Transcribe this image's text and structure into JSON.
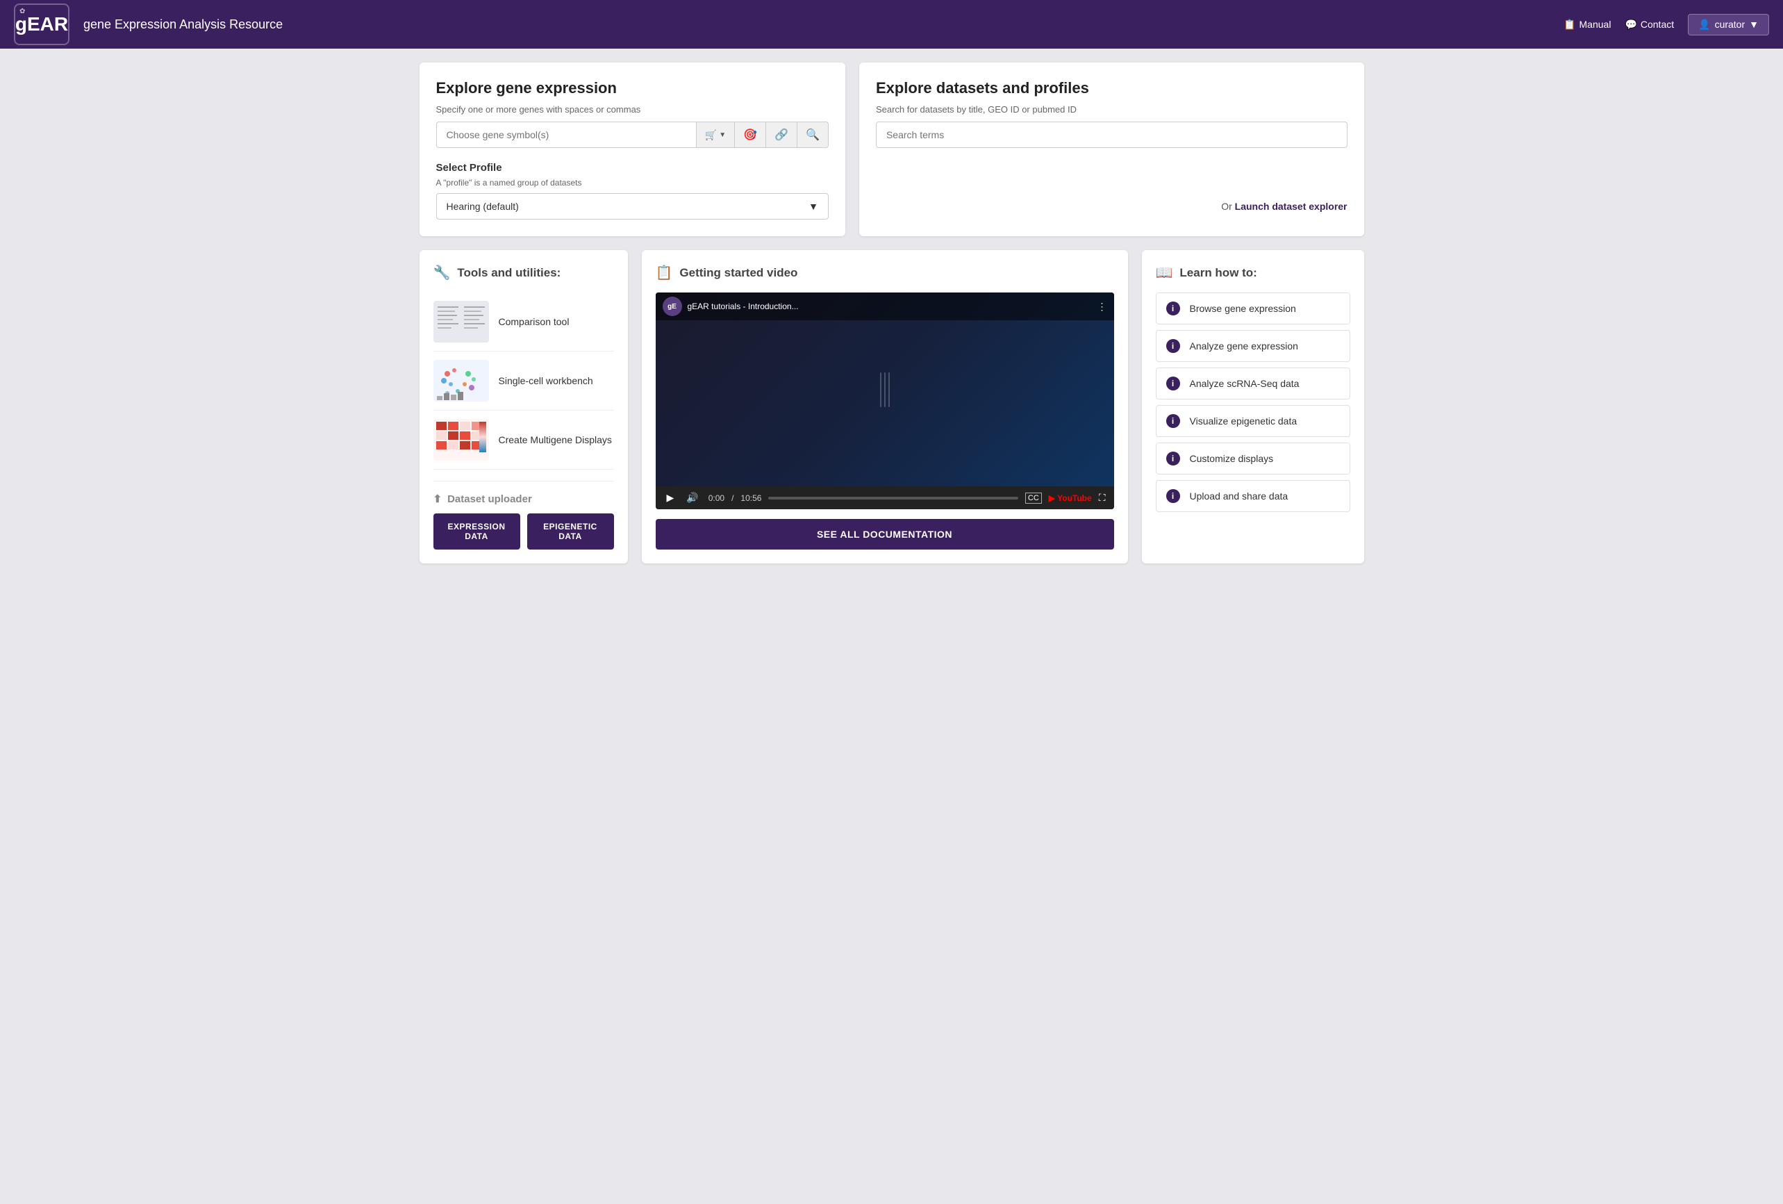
{
  "header": {
    "logo_text": "gEAR",
    "title": "gene Expression Analysis Resource",
    "manual_label": "Manual",
    "contact_label": "Contact",
    "curator_label": "curator"
  },
  "explore_gene": {
    "title": "Explore gene expression",
    "subtitle": "Specify one or more genes with spaces or commas",
    "input_placeholder": "Choose gene symbol(s)",
    "cart_label": "🛒",
    "profile_section_label": "Select Profile",
    "profile_desc": "A \"profile\" is a named group of datasets",
    "profile_value": "Hearing (default)"
  },
  "explore_datasets": {
    "title": "Explore datasets and profiles",
    "subtitle": "Search for datasets by title, GEO ID or pubmed ID",
    "search_placeholder": "Search terms",
    "launch_prefix": "Or ",
    "launch_label": "Launch dataset explorer"
  },
  "tools": {
    "section_label": "Tools and utilities:",
    "items": [
      {
        "label": "Comparison tool"
      },
      {
        "label": "Single-cell workbench"
      },
      {
        "label": "Create Multigene Displays"
      }
    ]
  },
  "dataset_uploader": {
    "label": "Dataset uploader",
    "btn_expression": "EXPRESSION DATA",
    "btn_epigenetic": "EPIGENETIC DATA"
  },
  "video": {
    "section_label": "Getting started video",
    "video_channel": "gEAR tutorials - Introduction...",
    "time_current": "0:00",
    "time_total": "10:56",
    "see_all_label": "SEE ALL DOCUMENTATION"
  },
  "learn": {
    "section_label": "Learn how to:",
    "items": [
      {
        "label": "Browse gene expression"
      },
      {
        "label": "Analyze gene expression"
      },
      {
        "label": "Analyze scRNA-Seq data"
      },
      {
        "label": "Visualize epigenetic data"
      },
      {
        "label": "Customize displays"
      },
      {
        "label": "Upload and share data"
      }
    ]
  },
  "icons": {
    "wrench": "🔧",
    "video": "📋",
    "book": "📖",
    "upload": "⬆",
    "info": "i",
    "play": "▶",
    "volume": "🔊",
    "cc": "CC",
    "fullscreen": "⛶",
    "gear": "⚙",
    "user": "👤",
    "target": "🎯",
    "link": "🔗",
    "search": "🔍",
    "chevron": "▼"
  }
}
